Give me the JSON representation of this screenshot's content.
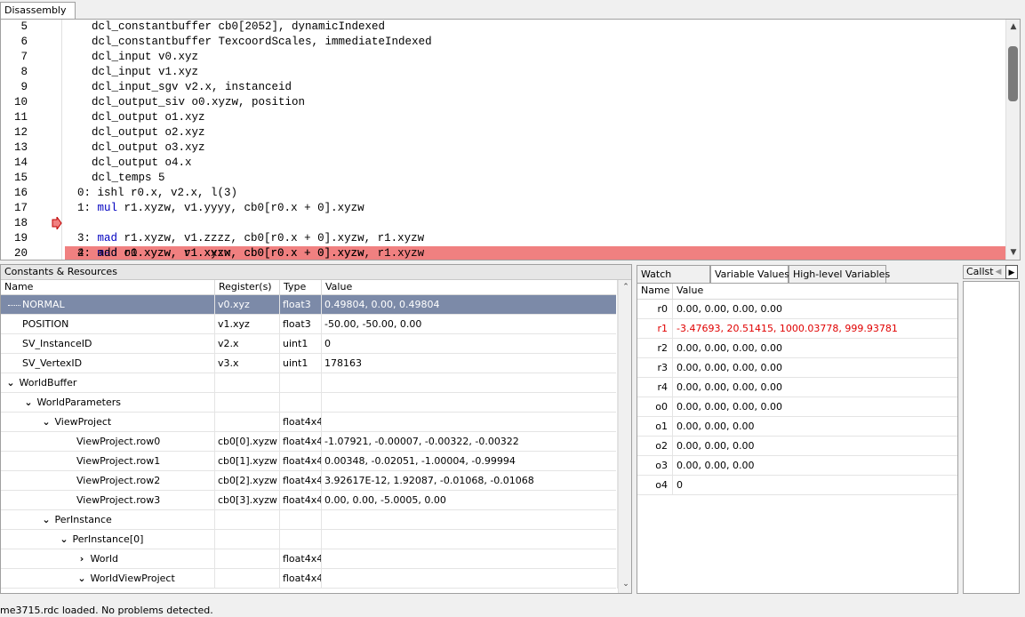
{
  "disassembly": {
    "tab_label": "Disassembly",
    "lines": [
      {
        "num": "5",
        "text": "    dcl_constantbuffer cb0[2052], dynamicIndexed"
      },
      {
        "num": "6",
        "text": "    dcl_constantbuffer TexcoordScales, immediateIndexed"
      },
      {
        "num": "7",
        "text": "    dcl_input v0.xyz"
      },
      {
        "num": "8",
        "text": "    dcl_input v1.xyz"
      },
      {
        "num": "9",
        "text": "    dcl_input_sgv v2.x, instanceid"
      },
      {
        "num": "10",
        "text": "    dcl_output_siv o0.xyzw, position"
      },
      {
        "num": "11",
        "text": "    dcl_output o1.xyz"
      },
      {
        "num": "12",
        "text": "    dcl_output o2.xyz"
      },
      {
        "num": "13",
        "text": "    dcl_output o3.xyz"
      },
      {
        "num": "14",
        "text": "    dcl_output o4.x"
      },
      {
        "num": "15",
        "text": "    dcl_temps 5"
      },
      {
        "num": "16",
        "text": "0: ishl r0.x, v2.x, l(3)"
      },
      {
        "num": "17",
        "idx": "1: ",
        "op": "mul",
        "rest": " r1.xyzw, v1.yyyy, cb0[r0.x + 0].xyzw"
      },
      {
        "num": "18",
        "idx": "2: ",
        "op": "mad",
        "rest": " r1.xyzw, v1.xxxx, cb0[r0.x + 0].xyzw, r1.xyzw",
        "current": true
      },
      {
        "num": "19",
        "idx": "3: ",
        "op": "mad",
        "rest": " r1.xyzw, v1.zzzz, cb0[r0.x + 0].xyzw, r1.xyzw"
      },
      {
        "num": "20",
        "text": "4: add o0.xyzw, r1.xyzw, cb0[r0.x + 0].xyzw"
      }
    ]
  },
  "constants": {
    "title": "Constants & Resources",
    "headers": {
      "name": "Name",
      "register": "Register(s)",
      "type": "Type",
      "value": "Value"
    },
    "rows": [
      {
        "name": "NORMAL",
        "register": "v0.xyz",
        "type": "float3",
        "value": "0.49804, 0.00, 0.49804"
      },
      {
        "name": "POSITION",
        "register": "v1.xyz",
        "type": "float3",
        "value": "-50.00, -50.00, 0.00"
      },
      {
        "name": "SV_InstanceID",
        "register": "v2.x",
        "type": "uint1",
        "value": "0"
      },
      {
        "name": "SV_VertexID",
        "register": "v3.x",
        "type": "uint1",
        "value": "178163"
      },
      {
        "name": "WorldBuffer",
        "register": "",
        "type": "",
        "value": ""
      },
      {
        "name": "WorldParameters",
        "register": "",
        "type": "",
        "value": ""
      },
      {
        "name": "ViewProject",
        "register": "",
        "type": "float4x4",
        "value": ""
      },
      {
        "name": "ViewProject.row0",
        "register": "cb0[0].xyzw",
        "type": "float4x4",
        "value": "-1.07921, -0.00007, -0.00322, -0.00322"
      },
      {
        "name": "ViewProject.row1",
        "register": "cb0[1].xyzw",
        "type": "float4x4",
        "value": "0.00348, -0.02051, -1.00004, -0.99994"
      },
      {
        "name": "ViewProject.row2",
        "register": "cb0[2].xyzw",
        "type": "float4x4",
        "value": "3.92617E-12, 1.92087, -0.01068, -0.01068"
      },
      {
        "name": "ViewProject.row3",
        "register": "cb0[3].xyzw",
        "type": "float4x4",
        "value": "0.00, 0.00, -5.0005, 0.00"
      },
      {
        "name": "PerInstance",
        "register": "",
        "type": "",
        "value": ""
      },
      {
        "name": "PerInstance[0]",
        "register": "",
        "type": "",
        "value": ""
      },
      {
        "name": "World",
        "register": "",
        "type": "float4x4",
        "value": ""
      },
      {
        "name": "WorldViewProject",
        "register": "",
        "type": "float4x4",
        "value": ""
      }
    ]
  },
  "watch": {
    "tabs": [
      "Watch",
      "Variable Values",
      "High-level Variables"
    ],
    "headers": {
      "name": "Name",
      "value": "Value"
    },
    "rows": [
      {
        "name": "r0",
        "value": "0.00, 0.00, 0.00, 0.00"
      },
      {
        "name": "r1",
        "value": "-3.47693, 20.51415, 1000.03778, 999.93781"
      },
      {
        "name": "r2",
        "value": "0.00, 0.00, 0.00, 0.00"
      },
      {
        "name": "r3",
        "value": "0.00, 0.00, 0.00, 0.00"
      },
      {
        "name": "r4",
        "value": "0.00, 0.00, 0.00, 0.00"
      },
      {
        "name": "o0",
        "value": "0.00, 0.00, 0.00, 0.00"
      },
      {
        "name": "o1",
        "value": "0.00, 0.00, 0.00"
      },
      {
        "name": "o2",
        "value": "0.00, 0.00, 0.00"
      },
      {
        "name": "o3",
        "value": "0.00, 0.00, 0.00"
      },
      {
        "name": "o4",
        "value": "0"
      }
    ]
  },
  "callstack": {
    "tab_label": "Callst"
  },
  "status": {
    "text": "me3715.rdc loaded. No problems detected."
  },
  "colors": {
    "current_line": "#f08080",
    "keyword": "#0000c0",
    "changed_value": "#e00000",
    "selection": "#7c8aa8"
  }
}
